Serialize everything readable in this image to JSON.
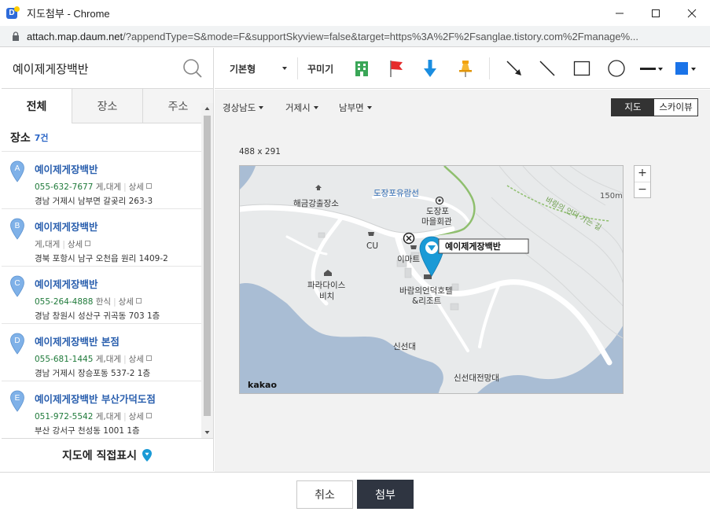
{
  "window": {
    "title": "지도첨부 - Chrome",
    "url_host": "attach.map.daum.net",
    "url_path": "/?appendType=S&mode=F&supportSkyview=false&target=https%3A%2F%2Fsanglae.tistory.com%2Fmanage%..."
  },
  "search": {
    "value": "예이제게장백반",
    "icon": "search-icon"
  },
  "tabs": [
    {
      "label": "전체",
      "active": true
    },
    {
      "label": "장소",
      "active": false
    },
    {
      "label": "주소",
      "active": false
    }
  ],
  "results": {
    "heading": "장소",
    "count": "7건",
    "detail_label": "상세",
    "items": [
      {
        "marker": "A",
        "name": "예이제게장백반",
        "tel": "055-632-7677",
        "category": "게,대게",
        "address": "경남 거제시 남부면 갈곶리 263-3"
      },
      {
        "marker": "B",
        "name": "예이제게장백반",
        "tel": "",
        "category": "게,대게",
        "address": "경북 포항시 남구 오천읍 원리 1409-2"
      },
      {
        "marker": "C",
        "name": "예이제게장백반",
        "tel": "055-264-4888",
        "category": "한식",
        "address": "경남 창원시 성산구 귀곡동 703 1층"
      },
      {
        "marker": "D",
        "name": "예이제게장백반 본점",
        "tel": "055-681-1445",
        "category": "게,대게",
        "address": "경남 거제시 장승포동 537-2 1층"
      },
      {
        "marker": "E",
        "name": "예이제게장백반 부산가덕도점",
        "tel": "051-972-5542",
        "category": "게,대게",
        "address": "부산 강서구 천성동 1001 1층"
      }
    ],
    "direct_label": "지도에 직접표시"
  },
  "toolbar": {
    "style_label": "기본형",
    "decorate_label": "꾸미기",
    "icons": [
      "building-icon",
      "flag-icon",
      "arrow-down-icon",
      "pin-icon",
      "arrow-line-icon",
      "line-icon",
      "rectangle-icon",
      "circle-icon",
      "line-style-icon",
      "color-icon"
    ],
    "accent_color": "#1a73e8"
  },
  "regions": [
    "경상남도",
    "거제시",
    "남부면"
  ],
  "map_type": {
    "map": "지도",
    "sky": "스카이뷰",
    "active": "map"
  },
  "map": {
    "size_label": "488 x 291",
    "marker_label": "예이제게장백반",
    "labels": {
      "haegeumgang": "해금강출장소",
      "dojangpo_cruise": "도장포유람선",
      "dojangpo_hall_1": "도장포",
      "dojangpo_hall_2": "마을회관",
      "cu": "CU",
      "emart": "이마트",
      "paradise_1": "파라다이스",
      "paradise_2": "비치",
      "hotel_1": "바람의언덕호텔",
      "hotel_2": "&리조트",
      "sinseondae": "신선대",
      "observatory": "신선대전망대",
      "contour": "150m",
      "trail": "바람의 언덕 가는 길",
      "kakao": "kakao"
    },
    "zoom_in": "+",
    "zoom_out": "−"
  },
  "footer": {
    "cancel": "취소",
    "attach": "첨부"
  }
}
